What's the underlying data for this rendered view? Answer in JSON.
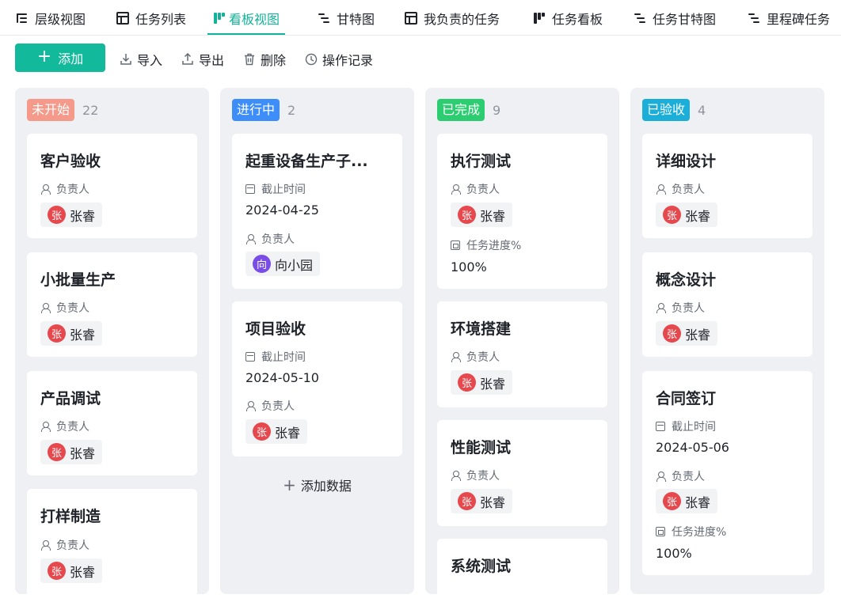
{
  "tabs": [
    {
      "label": "层级视图",
      "icon": "tree-icon",
      "active": false
    },
    {
      "label": "任务列表",
      "icon": "table-icon",
      "active": false
    },
    {
      "label": "看板视图",
      "icon": "board-icon",
      "active": true
    },
    {
      "label": "甘特图",
      "icon": "gantt-icon",
      "active": false
    },
    {
      "label": "我负责的任务",
      "icon": "table-icon",
      "active": false
    },
    {
      "label": "任务看板",
      "icon": "board-icon",
      "active": false
    },
    {
      "label": "任务甘特图",
      "icon": "gantt-icon",
      "active": false
    },
    {
      "label": "里程碑任务",
      "icon": "gantt-icon",
      "active": false
    }
  ],
  "toolbar": {
    "add_label": "添加",
    "import_label": "导入",
    "export_label": "导出",
    "delete_label": "删除",
    "history_label": "操作记录"
  },
  "labels": {
    "owner": "负责人",
    "deadline": "截止时间",
    "progress": "任务进度%",
    "add_data": "添加数据"
  },
  "colors": {
    "accent": "#12b39a",
    "not_started": "#f59a8a",
    "in_progress": "#3d8ef8",
    "done": "#2ccc71",
    "accepted": "#1aaed8",
    "avatar_zhang": "#e5484d",
    "avatar_xiang": "#7a4de6"
  },
  "columns": [
    {
      "status": "未开始",
      "count": "22",
      "cards": [
        {
          "title": "客户验收",
          "owner": "张睿",
          "owner_initial": "张"
        },
        {
          "title": "小批量生产",
          "owner": "张睿",
          "owner_initial": "张"
        },
        {
          "title": "产品调试",
          "owner": "张睿",
          "owner_initial": "张"
        },
        {
          "title": "打样制造",
          "owner": "张睿",
          "owner_initial": "张"
        }
      ]
    },
    {
      "status": "进行中",
      "count": "2",
      "cards": [
        {
          "title": "起重设备生产子...",
          "deadline": "2024-04-25",
          "owner": "向小园",
          "owner_initial": "向"
        },
        {
          "title": "项目验收",
          "deadline": "2024-05-10",
          "owner": "张睿",
          "owner_initial": "张"
        }
      ]
    },
    {
      "status": "已完成",
      "count": "9",
      "cards": [
        {
          "title": "执行测试",
          "owner": "张睿",
          "owner_initial": "张",
          "progress": "100%"
        },
        {
          "title": "环境搭建",
          "owner": "张睿",
          "owner_initial": "张"
        },
        {
          "title": "性能测试",
          "owner": "张睿",
          "owner_initial": "张"
        },
        {
          "title": "系统测试"
        }
      ]
    },
    {
      "status": "已验收",
      "count": "4",
      "cards": [
        {
          "title": "详细设计",
          "owner": "张睿",
          "owner_initial": "张"
        },
        {
          "title": "概念设计",
          "owner": "张睿",
          "owner_initial": "张"
        },
        {
          "title": "合同签订",
          "deadline": "2024-05-06",
          "owner": "张睿",
          "owner_initial": "张",
          "progress": "100%"
        }
      ]
    }
  ]
}
